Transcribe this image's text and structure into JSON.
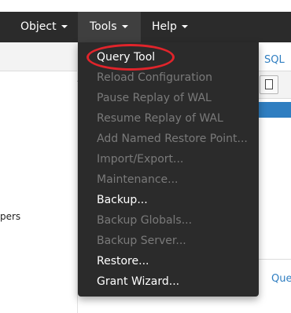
{
  "menubar": {
    "items": [
      {
        "label": "Object"
      },
      {
        "label": "Tools"
      },
      {
        "label": "Help"
      }
    ]
  },
  "background": {
    "sql_link": "SQL",
    "bottom_link": "Que",
    "side_text": "pers"
  },
  "tools_menu": {
    "items": [
      {
        "label": "Query Tool",
        "enabled": true
      },
      {
        "label": "Reload Configuration",
        "enabled": false
      },
      {
        "label": "Pause Replay of WAL",
        "enabled": false
      },
      {
        "label": "Resume Replay of WAL",
        "enabled": false
      },
      {
        "label": "Add Named Restore Point...",
        "enabled": false
      },
      {
        "label": "Import/Export...",
        "enabled": false
      },
      {
        "label": "Maintenance...",
        "enabled": false
      },
      {
        "label": "Backup...",
        "enabled": true
      },
      {
        "label": "Backup Globals...",
        "enabled": false
      },
      {
        "label": "Backup Server...",
        "enabled": false
      },
      {
        "label": "Restore...",
        "enabled": true
      },
      {
        "label": "Grant Wizard...",
        "enabled": true
      }
    ]
  },
  "colors": {
    "menu_bg": "#2b2b2b",
    "enabled_text": "#ffffff",
    "disabled_text": "#7a7a7a",
    "highlight_ring": "#e0242b",
    "link_blue": "#2f7ec1"
  }
}
